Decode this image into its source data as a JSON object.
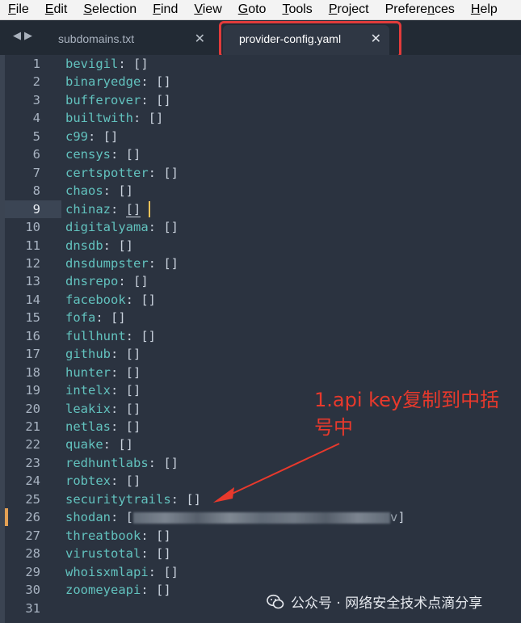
{
  "menubar": {
    "items": [
      {
        "label": "File",
        "mnemonic": "F",
        "rest": "ile"
      },
      {
        "label": "Edit",
        "mnemonic": "E",
        "rest": "dit"
      },
      {
        "label": "Selection",
        "mnemonic": "S",
        "rest": "election"
      },
      {
        "label": "Find",
        "mnemonic": "F",
        "rest": "ind"
      },
      {
        "label": "View",
        "mnemonic": "V",
        "rest": "iew"
      },
      {
        "label": "Goto",
        "mnemonic": "G",
        "rest": "oto"
      },
      {
        "label": "Tools",
        "mnemonic": "T",
        "rest": "ools"
      },
      {
        "label": "Project",
        "mnemonic": "P",
        "rest": "roject"
      },
      {
        "label": "Preferences",
        "mnemonic": "n",
        "pre": "Prefere",
        "rest": "ces"
      },
      {
        "label": "Help",
        "mnemonic": "H",
        "rest": "elp"
      }
    ]
  },
  "tabs": [
    {
      "label": "subdomains.txt",
      "active": false
    },
    {
      "label": "provider-config.yaml",
      "active": true
    }
  ],
  "editor": {
    "current_line": 9,
    "modified_line": 26,
    "lines": [
      {
        "n": "1",
        "key": "bevigil",
        "val": "[]"
      },
      {
        "n": "2",
        "key": "binaryedge",
        "val": "[]"
      },
      {
        "n": "3",
        "key": "bufferover",
        "val": "[]"
      },
      {
        "n": "4",
        "key": "builtwith",
        "val": "[]"
      },
      {
        "n": "5",
        "key": "c99",
        "val": "[]"
      },
      {
        "n": "6",
        "key": "censys",
        "val": "[]"
      },
      {
        "n": "7",
        "key": "certspotter",
        "val": "[]"
      },
      {
        "n": "8",
        "key": "chaos",
        "val": "[]"
      },
      {
        "n": "9",
        "key": "chinaz",
        "val": "[]"
      },
      {
        "n": "10",
        "key": "digitalyama",
        "val": "[]"
      },
      {
        "n": "11",
        "key": "dnsdb",
        "val": "[]"
      },
      {
        "n": "12",
        "key": "dnsdumpster",
        "val": "[]"
      },
      {
        "n": "13",
        "key": "dnsrepo",
        "val": "[]"
      },
      {
        "n": "14",
        "key": "facebook",
        "val": "[]"
      },
      {
        "n": "15",
        "key": "fofa",
        "val": "[]"
      },
      {
        "n": "16",
        "key": "fullhunt",
        "val": "[]"
      },
      {
        "n": "17",
        "key": "github",
        "val": "[]"
      },
      {
        "n": "18",
        "key": "hunter",
        "val": "[]"
      },
      {
        "n": "19",
        "key": "intelx",
        "val": "[]"
      },
      {
        "n": "20",
        "key": "leakix",
        "val": "[]"
      },
      {
        "n": "21",
        "key": "netlas",
        "val": "[]"
      },
      {
        "n": "22",
        "key": "quake",
        "val": "[]"
      },
      {
        "n": "23",
        "key": "redhuntlabs",
        "val": "[]"
      },
      {
        "n": "24",
        "key": "robtex",
        "val": "[]"
      },
      {
        "n": "25",
        "key": "securitytrails",
        "val": "[]"
      },
      {
        "n": "26",
        "key": "shodan",
        "val": "[v]"
      },
      {
        "n": "27",
        "key": "threatbook",
        "val": "[]"
      },
      {
        "n": "28",
        "key": "virustotal",
        "val": "[]"
      },
      {
        "n": "29",
        "key": "whoisxmlapi",
        "val": "[]"
      },
      {
        "n": "30",
        "key": "zoomeyeapi",
        "val": "[]"
      },
      {
        "n": "31",
        "key": "",
        "val": ""
      }
    ]
  },
  "annotation": {
    "text": "1.api key复制到中括号中",
    "color": "#e8392c"
  },
  "watermark": {
    "text": "公众号 · 网络安全技术点滴分享"
  },
  "colors": {
    "key": "#62c2be",
    "background": "#2b3340",
    "highlight_box": "#e23b3b",
    "caret": "#f3c35a",
    "modified_marker": "#e3a054"
  }
}
